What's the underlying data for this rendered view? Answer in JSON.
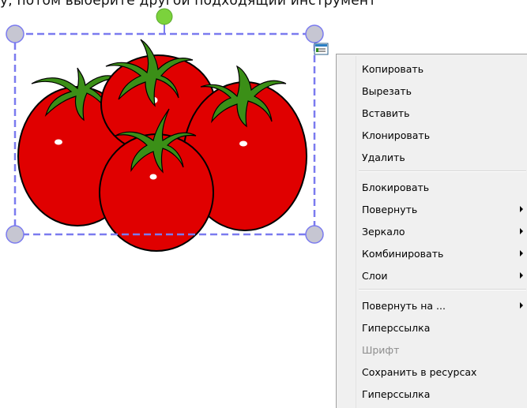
{
  "background_text": "у, потом выберите другой подходящий инструмент",
  "canvas": {
    "selected_object": "tomatoes-image",
    "selection_color": "#7b7bef",
    "handle_color": "#c6c6d2",
    "rotate_handle_color": "#7bd23c",
    "tomato_color": "#e00000",
    "leaf_color": "#2e8b1a",
    "menu_button_icon": "object-menu-icon"
  },
  "context_menu": {
    "groups": [
      {
        "items": [
          {
            "label": "Копировать",
            "has_submenu": false,
            "enabled": true
          },
          {
            "label": "Вырезать",
            "has_submenu": false,
            "enabled": true
          },
          {
            "label": "Вставить",
            "has_submenu": false,
            "enabled": true
          },
          {
            "label": "Клонировать",
            "has_submenu": false,
            "enabled": true
          },
          {
            "label": "Удалить",
            "has_submenu": false,
            "enabled": true
          }
        ]
      },
      {
        "items": [
          {
            "label": "Блокировать",
            "has_submenu": false,
            "enabled": true
          },
          {
            "label": "Повернуть",
            "has_submenu": true,
            "enabled": true
          },
          {
            "label": "Зеркало",
            "has_submenu": true,
            "enabled": true
          },
          {
            "label": "Комбинировать",
            "has_submenu": true,
            "enabled": true
          },
          {
            "label": "Слои",
            "has_submenu": true,
            "enabled": true
          }
        ]
      },
      {
        "items": [
          {
            "label": "Повернуть на ...",
            "has_submenu": true,
            "enabled": true
          },
          {
            "label": "Гиперссылка",
            "has_submenu": false,
            "enabled": true
          },
          {
            "label": "Шрифт",
            "has_submenu": false,
            "enabled": false
          },
          {
            "label": "Сохранить в ресурсах",
            "has_submenu": false,
            "enabled": true
          },
          {
            "label": "Гиперссылка",
            "has_submenu": false,
            "enabled": true
          }
        ]
      }
    ]
  }
}
